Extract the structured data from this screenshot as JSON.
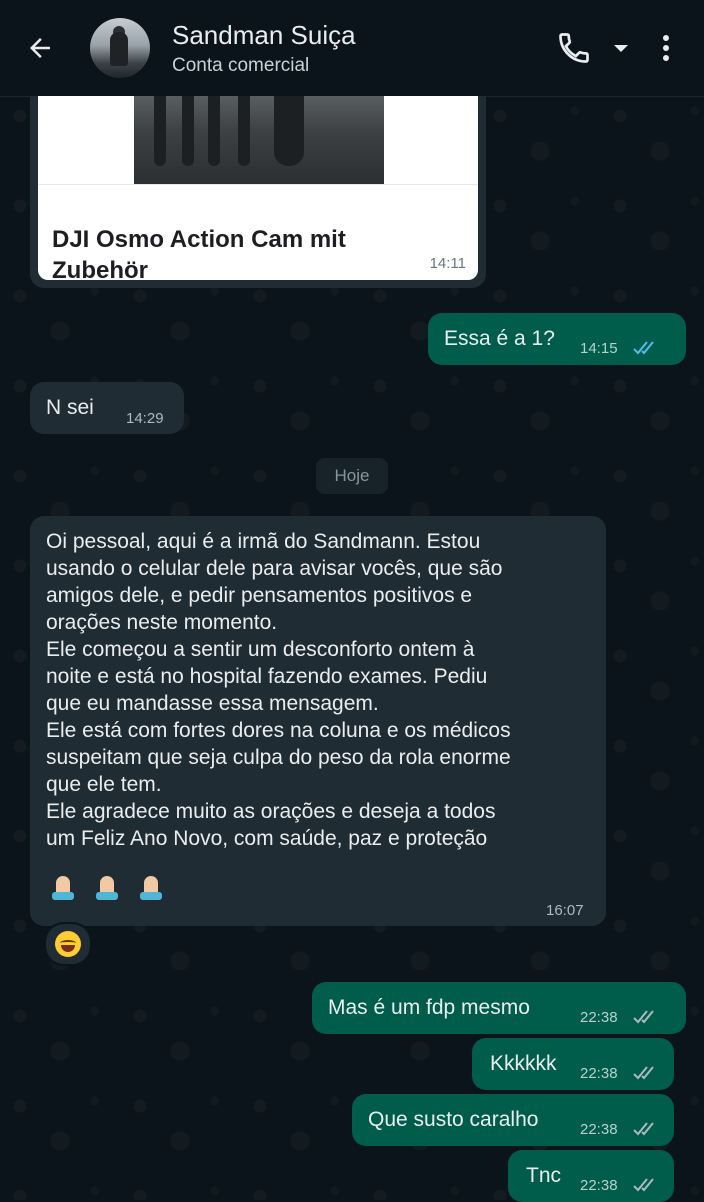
{
  "header": {
    "contact_name": "Sandman Suiça",
    "contact_subtitle": "Conta comercial",
    "back_icon": "arrow-left-icon",
    "call_icon": "phone-icon",
    "call_menu_icon": "caret-down-icon",
    "menu_icon": "more-vert-icon"
  },
  "messages": [
    {
      "type": "link",
      "direction": "in",
      "title": "DJI Osmo Action Cam mit Zubehör",
      "time": "14:11"
    },
    {
      "type": "text",
      "direction": "out",
      "text": "Essa é a 1?",
      "time": "14:15",
      "status": "read"
    },
    {
      "type": "text",
      "direction": "in",
      "text": "N sei",
      "time": "14:29"
    },
    {
      "type": "date",
      "text": "Hoje"
    },
    {
      "type": "text",
      "direction": "in",
      "text": "Oi pessoal, aqui é a irmã do Sandmann. Estou\nusando o celular dele para avisar vocês, que são\namigos dele, e pedir pensamentos positivos e\norações neste momento.\nEle começou a sentir um desconforto ontem à\nnoite e está no hospital fazendo exames. Pediu\nque eu mandasse essa mensagem.\nEle está com fortes dores na coluna e os médicos\nsuspeitam que seja culpa do peso da rola enorme\nque ele tem.\nEle agradece muito as orações e deseja a todos\num Feliz Ano Novo, com saúde, paz e proteção",
      "emoji_icons": [
        "folded-hands-icon",
        "folded-hands-icon",
        "folded-hands-icon"
      ],
      "time": "16:07",
      "reaction_icon": "face-with-tears-of-joy-icon"
    },
    {
      "type": "text",
      "direction": "out",
      "text": "Mas é um fdp mesmo",
      "time": "22:38",
      "status": "delivered"
    },
    {
      "type": "text",
      "direction": "out",
      "text": "Kkkkkk",
      "time": "22:38",
      "status": "delivered"
    },
    {
      "type": "text",
      "direction": "out",
      "text": "Que susto caralho",
      "time": "22:38",
      "status": "delivered"
    },
    {
      "type": "text",
      "direction": "out",
      "text": "Tnc",
      "time": "22:38",
      "status": "delivered"
    }
  ],
  "colors": {
    "background": "#0b141a",
    "incoming_bubble": "#202c33",
    "outgoing_bubble": "#005c4b",
    "read_ticks": "#53bdeb",
    "delivered_ticks": "#aebac1"
  }
}
